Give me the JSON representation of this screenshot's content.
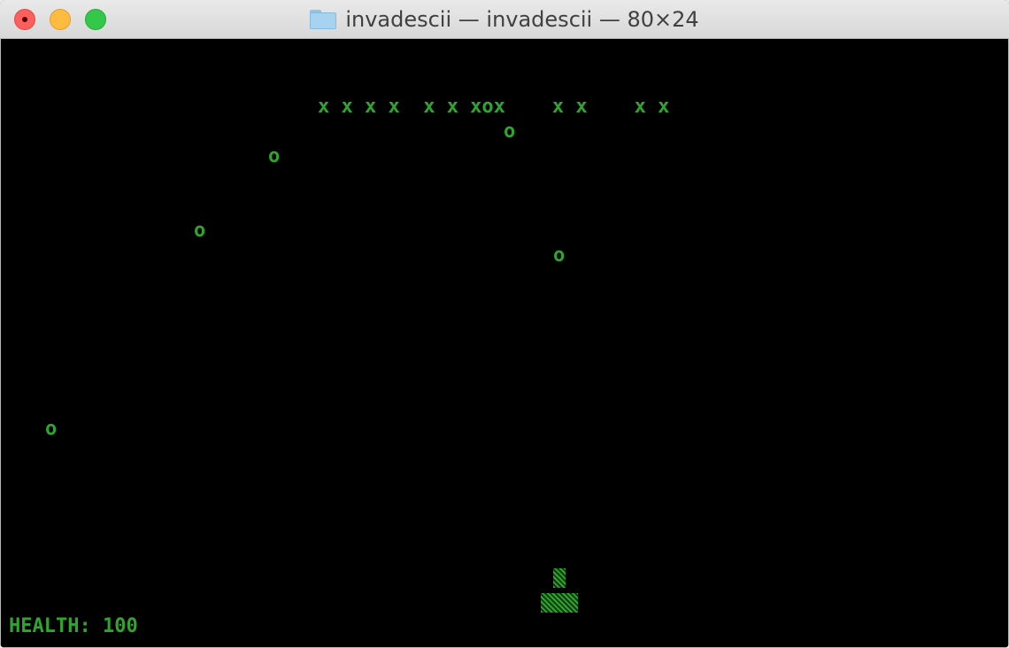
{
  "window": {
    "title": "invadescii — invadescii — 80×24",
    "folder_icon": "folder-icon"
  },
  "colors": {
    "terminal_bg": "#000000",
    "terminal_fg": "#2fa52f"
  },
  "game": {
    "invader_rows": [
      "x x x x  x x xox    x x    x x"
    ],
    "bullets": [
      "o",
      "o",
      "o",
      "o",
      "o"
    ],
    "player": "▓",
    "player_base": "▓▓▓",
    "health_label": "HEALTH: 100"
  }
}
